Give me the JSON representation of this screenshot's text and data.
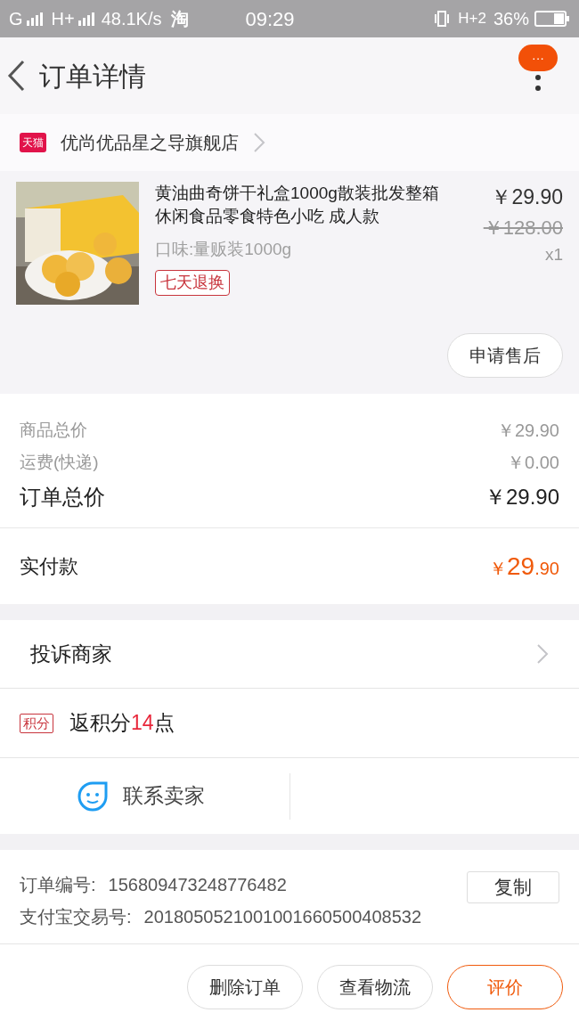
{
  "status_bar": {
    "network_1": "G",
    "network_2": "H+",
    "speed": "48.1K/s",
    "app_glyph": "淘",
    "time": "09:29",
    "network_3": "H+2",
    "battery": "36%"
  },
  "header": {
    "title": "订单详情",
    "badge": "···"
  },
  "shop": {
    "logo": "天猫",
    "name": "优尚优品星之导旗舰店"
  },
  "product": {
    "title": "黄油曲奇饼干礼盒1000g散装批发整箱休闲食品零食特色小吃 成人款",
    "variant": "口味:量贩装1000g",
    "tag": "七天退换",
    "price": "￥29.90",
    "original_price": "￥128.00",
    "quantity": "x1",
    "after_sale_button": "申请售后"
  },
  "costs": [
    {
      "label": "商品总价",
      "value": "￥29.90",
      "kind": "minor"
    },
    {
      "label": "运费(快递)",
      "value": "￥0.00",
      "kind": "minor"
    },
    {
      "label": "订单总价",
      "value": "￥29.90",
      "kind": "major"
    }
  ],
  "payment": {
    "label": "实付款",
    "currency": "￥",
    "integer": "29",
    "decimal": ".90"
  },
  "complaint": {
    "label": "投诉商家"
  },
  "points": {
    "badge": "积分",
    "text_before": "返积分",
    "number": "14",
    "text_after": "点"
  },
  "contact": {
    "label": "联系卖家"
  },
  "order_info": [
    {
      "label": "订单编号:",
      "value": "156809473248776482"
    },
    {
      "label": "支付宝交易号:",
      "value": "2018050521001001660500408532"
    }
  ],
  "copy_button": "复制",
  "actions": [
    {
      "label": "删除订单",
      "kind": "normal"
    },
    {
      "label": "查看物流",
      "kind": "normal"
    },
    {
      "label": "评价",
      "kind": "primary"
    }
  ]
}
